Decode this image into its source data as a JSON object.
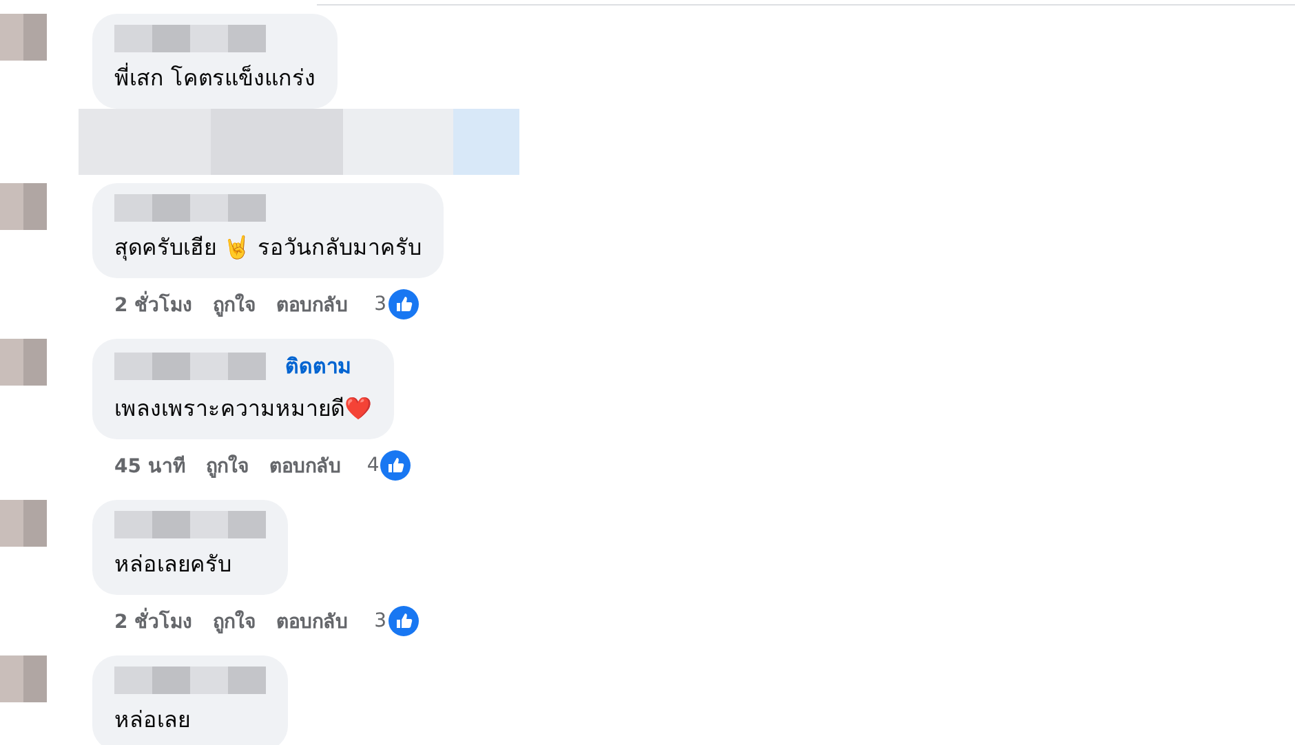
{
  "comments": [
    {
      "text": "พี่เสก โคตรแข็งแกร่ง",
      "meta_covered": true
    },
    {
      "text": "สุดครับเฮีย 🤘 รอวันกลับมาครับ",
      "meta_covered": false,
      "meta": {
        "time": "2 ชั่วโมง",
        "like": "ถูกใจ",
        "reply": "ตอบกลับ",
        "count": "3"
      }
    },
    {
      "text": "เพลงเพราะความหมายดี❤️",
      "follow": "ติดตาม",
      "meta_covered": false,
      "meta": {
        "time": "45 นาที",
        "like": "ถูกใจ",
        "reply": "ตอบกลับ",
        "count": "4"
      }
    },
    {
      "text": "หล่อเลยครับ",
      "meta_covered": false,
      "meta": {
        "time": "2 ชั่วโมง",
        "like": "ถูกใจ",
        "reply": "ตอบกลับ",
        "count": "3"
      }
    },
    {
      "text": "หล่อเลย",
      "meta_covered": false
    }
  ]
}
